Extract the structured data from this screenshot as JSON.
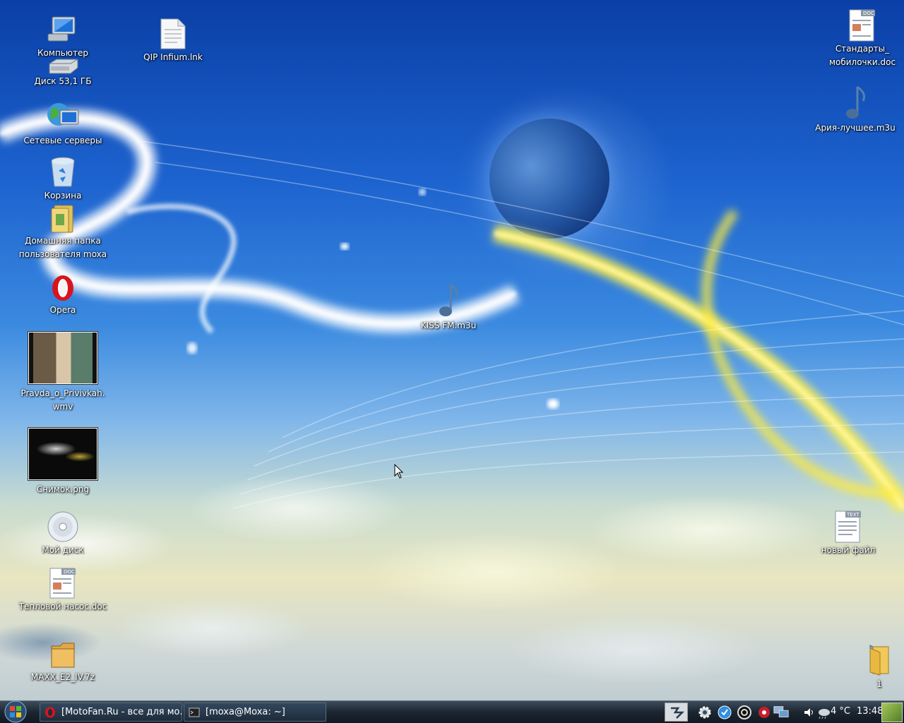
{
  "desktop": {
    "left_icons": [
      {
        "label": "Компьютер",
        "icon": "computer-icon"
      },
      {
        "label": "Диск 53,1 ГБ",
        "icon": "hard-disk-icon"
      },
      {
        "label": "Сетевые серверы",
        "icon": "network-servers-icon"
      },
      {
        "label": "Корзина",
        "icon": "trash-icon"
      },
      {
        "label": "Домашняя папка\nпользователя moxa",
        "icon": "home-folder-icon"
      },
      {
        "label": "Opera",
        "icon": "opera-icon"
      },
      {
        "label": "Pravda_o_Privivkah.\nwmv",
        "icon": "video-thumbnail"
      },
      {
        "label": "Снимок.png",
        "icon": "image-thumbnail"
      },
      {
        "label": "Мой диск",
        "icon": "cd-icon"
      },
      {
        "label": "Тепловой насос.doc",
        "icon": "doc-icon"
      },
      {
        "label": "MAXX_E2_IV.7z",
        "icon": "archive-icon"
      }
    ],
    "qip": {
      "label": "QIP Infium.lnk",
      "icon": "file-icon"
    },
    "kiss": {
      "label": "KISS FM.m3u",
      "icon": "music-note-icon"
    },
    "right_icons": [
      {
        "label": "Стандарты_\nмобилочки.doc",
        "icon": "doc-icon"
      },
      {
        "label": "Ария-лучшее.m3u",
        "icon": "music-note-icon"
      },
      {
        "label": "новый файл",
        "icon": "text-file-icon"
      },
      {
        "label": "1",
        "icon": "folder-icon"
      }
    ]
  },
  "taskbar": {
    "windows": [
      {
        "title": "[MotoFan.Ru - все для мо...",
        "icon": "opera-icon"
      },
      {
        "title": "[moxa@Moxa: ~]",
        "icon": "terminal-icon"
      }
    ],
    "temperature": "4 °C",
    "clock": "13:48"
  },
  "colors": {
    "taskbar": "#1c2631",
    "label_text": "#ffffff",
    "sky_top": "#0a3fa6"
  }
}
